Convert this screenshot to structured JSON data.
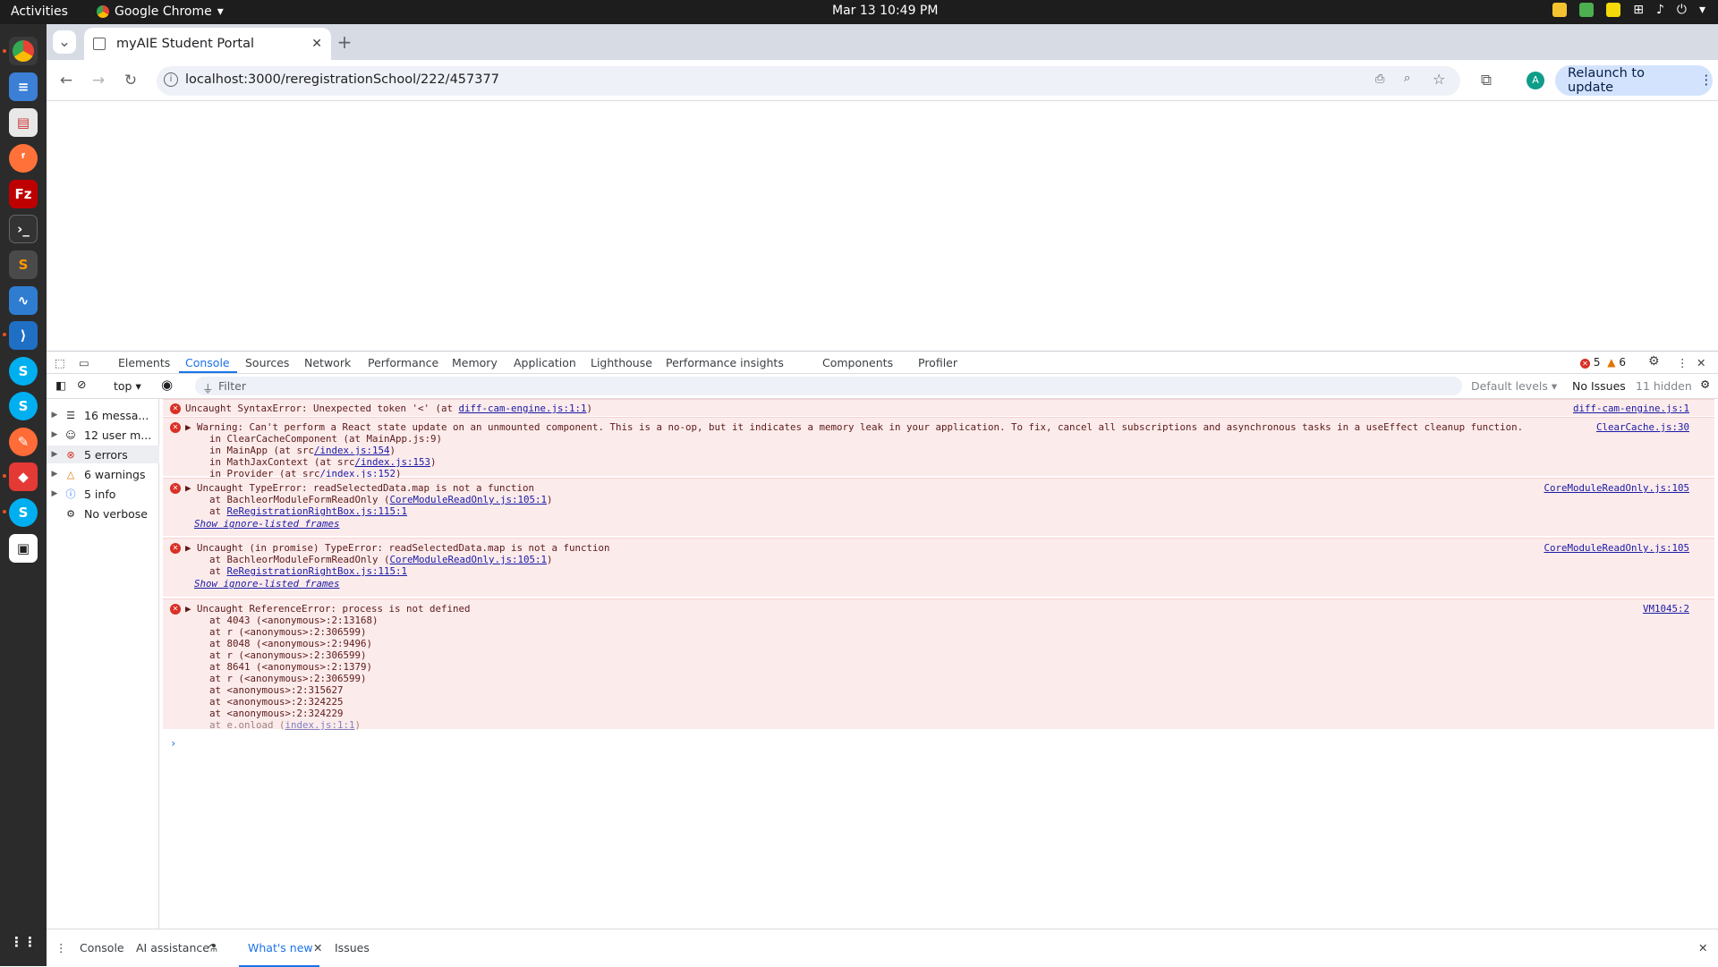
{
  "desktop": {
    "activities": "Activities",
    "app_name": "Google Chrome",
    "clock": "Mar 13  10:49 PM"
  },
  "browser": {
    "tab_title": "myAIE Student Portal",
    "url": "localhost:3000/reregistrationSchool/222/457377",
    "relaunch": "Relaunch to update",
    "profile_initial": "A"
  },
  "devtools": {
    "tabs": [
      "Elements",
      "Console",
      "Sources",
      "Network",
      "Performance",
      "Memory",
      "Application",
      "Lighthouse",
      "Performance insights",
      "Components",
      "Profiler"
    ],
    "error_count": "5",
    "warning_count": "6",
    "context": "top",
    "filter_placeholder": "Filter",
    "levels": "Default levels",
    "issues": "No Issues",
    "hidden": "11 hidden",
    "sidebar": [
      {
        "label": "16 messa...",
        "icon": "list-icon"
      },
      {
        "label": "12 user m...",
        "icon": "user-icon"
      },
      {
        "label": "5 errors",
        "icon": "error-icon"
      },
      {
        "label": "6 warnings",
        "icon": "warning-icon"
      },
      {
        "label": "5 info",
        "icon": "info-icon"
      },
      {
        "label": "No verbose",
        "icon": "gear-icon"
      }
    ],
    "messages": {
      "m1": {
        "text": "Uncaught SyntaxError: Unexpected token '<' (at ",
        "link": "diff-cam-engine.js:1:1",
        "tail": ")",
        "source": "diff-cam-engine.js:1"
      },
      "m2": {
        "text": "Warning: Can't perform a React state update on an unmounted component. This is a no-op, but it indicates a memory leak in your application. To fix, cancel all subscriptions and asynchronous tasks in a useEffect cleanup function.",
        "source": "ClearCache.js:30",
        "l1": "in ClearCacheComponent (at MainApp.js:9)",
        "l2a": "in MainApp (at src",
        "l2b": "/index.js:154",
        "l2c": ")",
        "l3a": "in MathJaxContext (at src",
        "l3b": "/index.js:153",
        "l3c": ")",
        "l4a": "in Provider (at src",
        "l4b": "/index.js:152",
        "l4c": ")"
      },
      "m3": {
        "text": "Uncaught TypeError: readSelectedData.map is not a function",
        "source": "CoreModuleReadOnly.js:105",
        "l1a": "at BachleorModuleFormReadOnly (",
        "l1b": "CoreModuleReadOnly.js:105:1",
        "l1c": ")",
        "l2a": "at ",
        "l2b": "ReRegistrationRightBox.js:115:1",
        "ign": "Show ignore-listed frames"
      },
      "m4": {
        "text": "Uncaught (in promise) TypeError: readSelectedData.map is not a function",
        "source": "CoreModuleReadOnly.js:105",
        "l1a": "at BachleorModuleFormReadOnly (",
        "l1b": "CoreModuleReadOnly.js:105:1",
        "l1c": ")",
        "l2a": "at ",
        "l2b": "ReRegistrationRightBox.js:115:1",
        "ign": "Show ignore-listed frames"
      },
      "m5": {
        "text": "Uncaught ReferenceError: process is not defined",
        "source": "VM1045:2",
        "stack": [
          "at 4043 (<anonymous>:2:13168)",
          "at r (<anonymous>:2:306599)",
          "at 8048 (<anonymous>:2:9496)",
          "at r (<anonymous>:2:306599)",
          "at 8641 (<anonymous>:2:1379)",
          "at r (<anonymous>:2:306599)",
          "at <anonymous>:2:315627",
          "at <anonymous>:2:324225",
          "at <anonymous>:2:324229"
        ],
        "last_a": "at e.onload (",
        "last_b": "index.js:1:1",
        "last_c": ")"
      }
    },
    "drawer": [
      "Console",
      "AI assistance",
      "What's new",
      "Issues"
    ]
  }
}
